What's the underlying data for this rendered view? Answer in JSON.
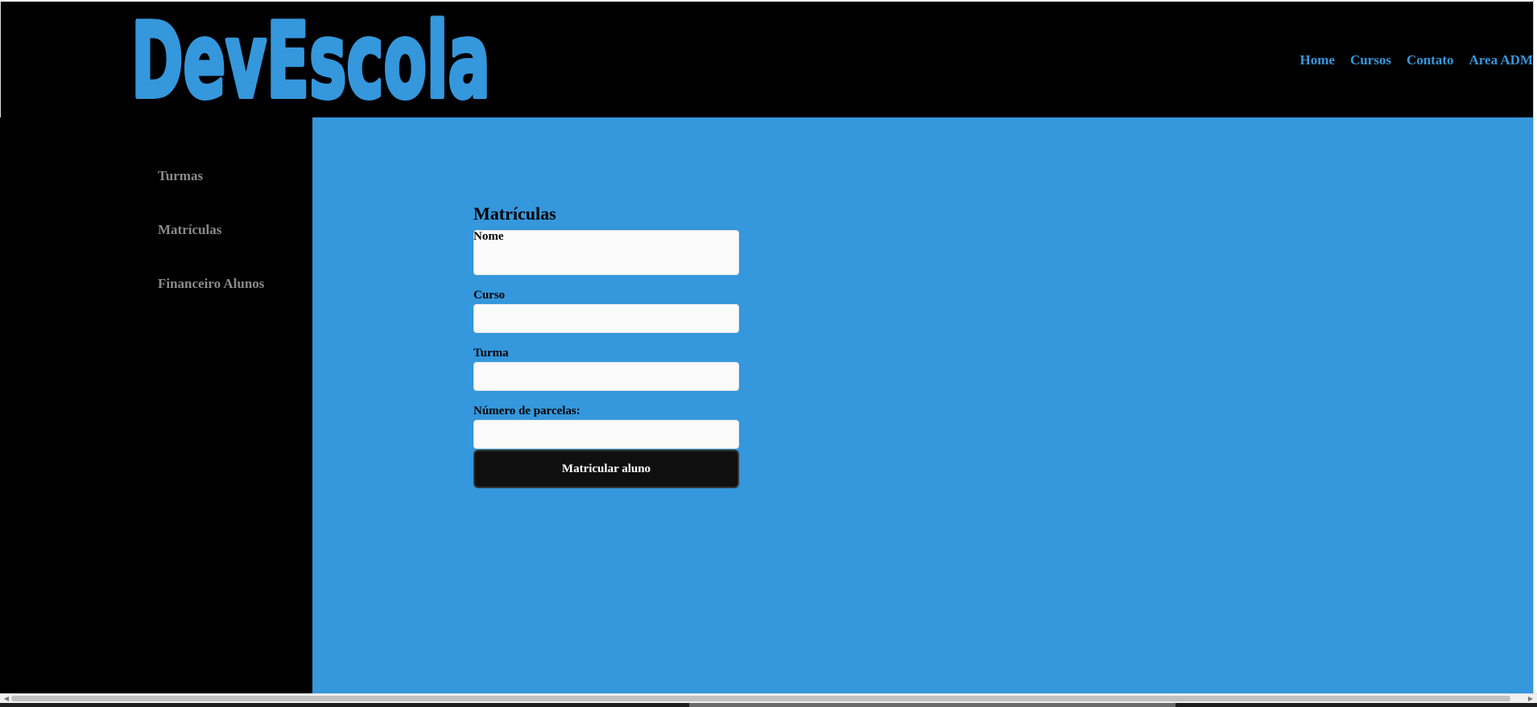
{
  "app": {
    "logo_text": "DevEscola"
  },
  "nav": {
    "items": [
      {
        "label": "Home"
      },
      {
        "label": "Cursos"
      },
      {
        "label": "Contato"
      },
      {
        "label": "Area ADM"
      }
    ]
  },
  "sidebar": {
    "items": [
      {
        "label": "Turmas"
      },
      {
        "label": "Matrículas"
      },
      {
        "label": "Financeiro Alunos"
      }
    ]
  },
  "form": {
    "title": "Matrículas",
    "fields": [
      {
        "label": "Nome",
        "value": ""
      },
      {
        "label": "Curso",
        "value": ""
      },
      {
        "label": "Turma",
        "value": ""
      },
      {
        "label": "Número de parcelas:",
        "value": ""
      }
    ],
    "submit_label": "Matricular aluno"
  },
  "colors": {
    "brand_blue": "#3597dc",
    "background": "#000000",
    "button": "#0f0f0f"
  }
}
